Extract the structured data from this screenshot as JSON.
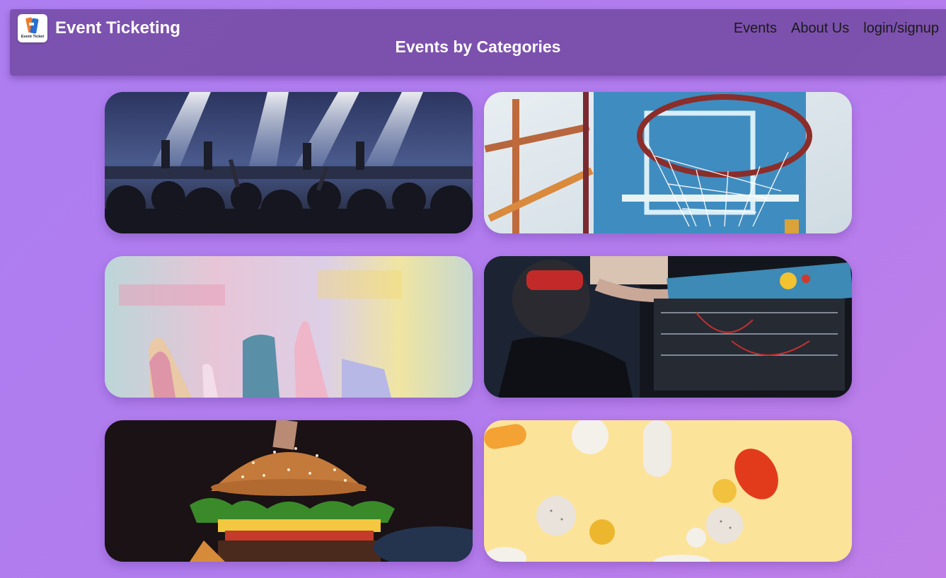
{
  "header": {
    "logo_text": "Event Ticket",
    "app_title": "Event Ticketing",
    "page_title": "Events by Categories",
    "nav": [
      {
        "label": "Events"
      },
      {
        "label": "About Us"
      },
      {
        "label": "login/signup"
      }
    ]
  },
  "categories": [
    {
      "icon": "concert-photo"
    },
    {
      "icon": "basketball-hoop-photo"
    },
    {
      "icon": "paint-brushes-photo"
    },
    {
      "icon": "robotics-photo"
    },
    {
      "icon": "burger-photo"
    },
    {
      "icon": "pills-photo"
    }
  ]
}
